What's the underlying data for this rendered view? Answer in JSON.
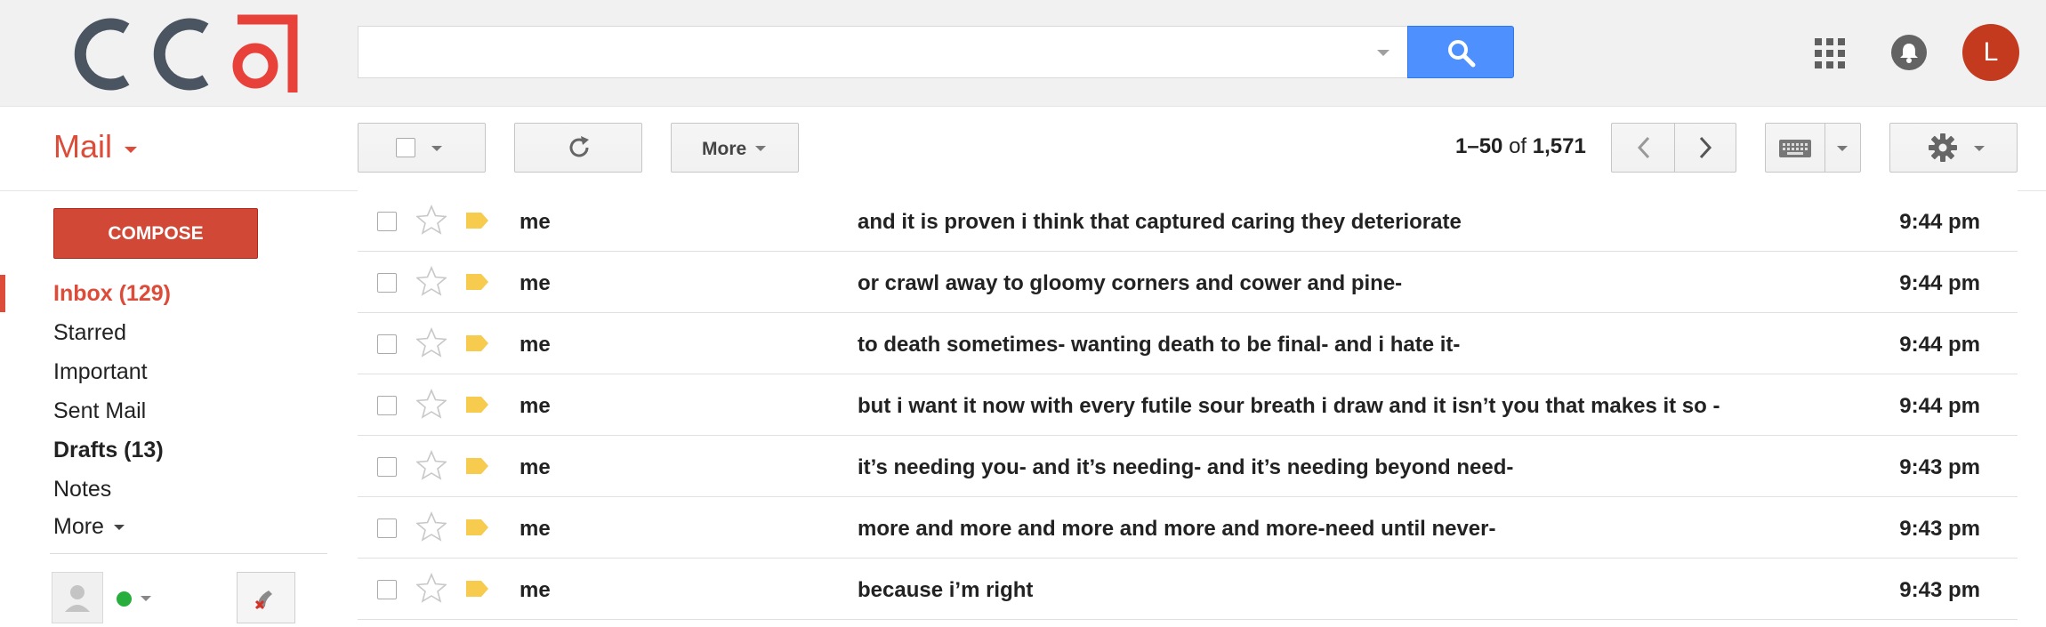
{
  "header": {
    "logo_text": "CCO",
    "search": {
      "value": "",
      "placeholder": ""
    },
    "avatar_initial": "L"
  },
  "colors": {
    "accent": "#dd4b39",
    "compose": "#d14836",
    "search_button": "#4d90fe",
    "avatar": "#c33a1f",
    "label_tag": "#f7cb4d",
    "status_online": "#27ae3c"
  },
  "toolbar": {
    "app_label": "Mail",
    "more_label": "More",
    "pager": {
      "range": "1–50",
      "of": "of",
      "total": "1,571"
    }
  },
  "sidebar": {
    "compose_label": "COMPOSE",
    "items": [
      {
        "label": "Inbox (129)",
        "active": true,
        "bold": true
      },
      {
        "label": "Starred",
        "active": false,
        "bold": false
      },
      {
        "label": "Important",
        "active": false,
        "bold": false
      },
      {
        "label": "Sent Mail",
        "active": false,
        "bold": false
      },
      {
        "label": "Drafts (13)",
        "active": false,
        "bold": true
      },
      {
        "label": "Notes",
        "active": false,
        "bold": false
      },
      {
        "label": "More",
        "active": false,
        "bold": false
      }
    ]
  },
  "messages": [
    {
      "sender": "me",
      "subject": "and it is proven i think that captured caring they deteriorate",
      "time": "9:44 pm"
    },
    {
      "sender": "me",
      "subject": "or crawl away to gloomy corners and cower and pine-",
      "time": "9:44 pm"
    },
    {
      "sender": "me",
      "subject": "to death sometimes- wanting death to be final- and i hate it-",
      "time": "9:44 pm"
    },
    {
      "sender": "me",
      "subject": "but i want it now with every futile sour breath i draw and it isn’t you that makes it so -",
      "time": "9:44 pm"
    },
    {
      "sender": "me",
      "subject": "it’s needing you- and it’s needing- and it’s needing beyond need-",
      "time": "9:43 pm"
    },
    {
      "sender": "me",
      "subject": "more and more and more and more and more-need until never-",
      "time": "9:43 pm"
    },
    {
      "sender": "me",
      "subject": "because i’m right",
      "time": "9:43 pm"
    }
  ],
  "icons": {
    "search": "search-icon",
    "apps": "apps-grid-icon",
    "notifications": "bell-icon",
    "refresh": "refresh-icon",
    "keyboard": "keyboard-icon",
    "settings": "gear-icon",
    "star": "star-icon",
    "label": "label-tag-icon",
    "phone": "phone-icon"
  }
}
